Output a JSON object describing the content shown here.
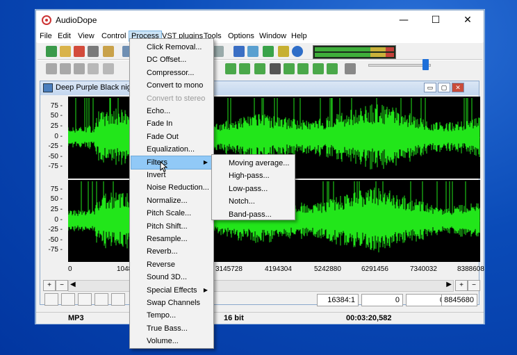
{
  "window": {
    "title": "AudioDope",
    "minimize": "—",
    "maximize": "☐",
    "close": "✕"
  },
  "menubar": [
    "File",
    "Edit",
    "View",
    "Control",
    "Process",
    "VST plugins",
    "Tools",
    "Options",
    "Window",
    "Help"
  ],
  "active_menu": "Process",
  "child_window": {
    "title": "Deep Purple  Black night (",
    "buttons": [
      "▭",
      "▢",
      "✕"
    ]
  },
  "scale_labels": [
    "75 -",
    "50 -",
    "25 -",
    "0 -",
    "-25 -",
    "-50 -",
    "-75 -"
  ],
  "ruler_labels": [
    "0",
    "10485",
    "3145728",
    "4194304",
    "5242880",
    "6291456",
    "7340032",
    "8388608"
  ],
  "fields": {
    "zoom_ratio": "16384:1",
    "sel_start": "0",
    "sel_end": "0",
    "length": "8845680"
  },
  "status": {
    "format": "MP3",
    "bits": "16 bit",
    "time": "00:03:20,582"
  },
  "process_menu": [
    {
      "label": "Click Removal...",
      "enabled": true
    },
    {
      "label": "DC Offset...",
      "enabled": true
    },
    {
      "label": "Compressor...",
      "enabled": true
    },
    {
      "label": "Convert to mono",
      "enabled": true
    },
    {
      "label": "Convert to stereo",
      "enabled": false
    },
    {
      "label": "Echo...",
      "enabled": true
    },
    {
      "label": "Fade In",
      "enabled": true
    },
    {
      "label": "Fade Out",
      "enabled": true
    },
    {
      "label": "Equalization...",
      "enabled": true
    },
    {
      "label": "Filters",
      "enabled": true,
      "submenu": true,
      "highlighted": true
    },
    {
      "label": "Invert",
      "enabled": true
    },
    {
      "label": "Noise Reduction...",
      "enabled": true
    },
    {
      "label": "Normalize...",
      "enabled": true
    },
    {
      "label": "Pitch Scale...",
      "enabled": true
    },
    {
      "label": "Pitch Shift...",
      "enabled": true
    },
    {
      "label": "Resample...",
      "enabled": true
    },
    {
      "label": "Reverb...",
      "enabled": true
    },
    {
      "label": "Reverse",
      "enabled": true
    },
    {
      "label": "Sound 3D...",
      "enabled": true
    },
    {
      "label": "Special Effects",
      "enabled": true,
      "submenu": true
    },
    {
      "label": "Swap Channels",
      "enabled": true
    },
    {
      "label": "Tempo...",
      "enabled": true
    },
    {
      "label": "True Bass...",
      "enabled": true
    },
    {
      "label": "Volume...",
      "enabled": true
    }
  ],
  "filters_submenu": [
    "Moving average...",
    "High-pass...",
    "Low-pass...",
    "Notch...",
    "Band-pass..."
  ],
  "colors": {
    "waveform": "#22e61a",
    "wave_bg": "#000000",
    "accent": "#1e6fd9",
    "menu_hover": "#91c9f7"
  }
}
